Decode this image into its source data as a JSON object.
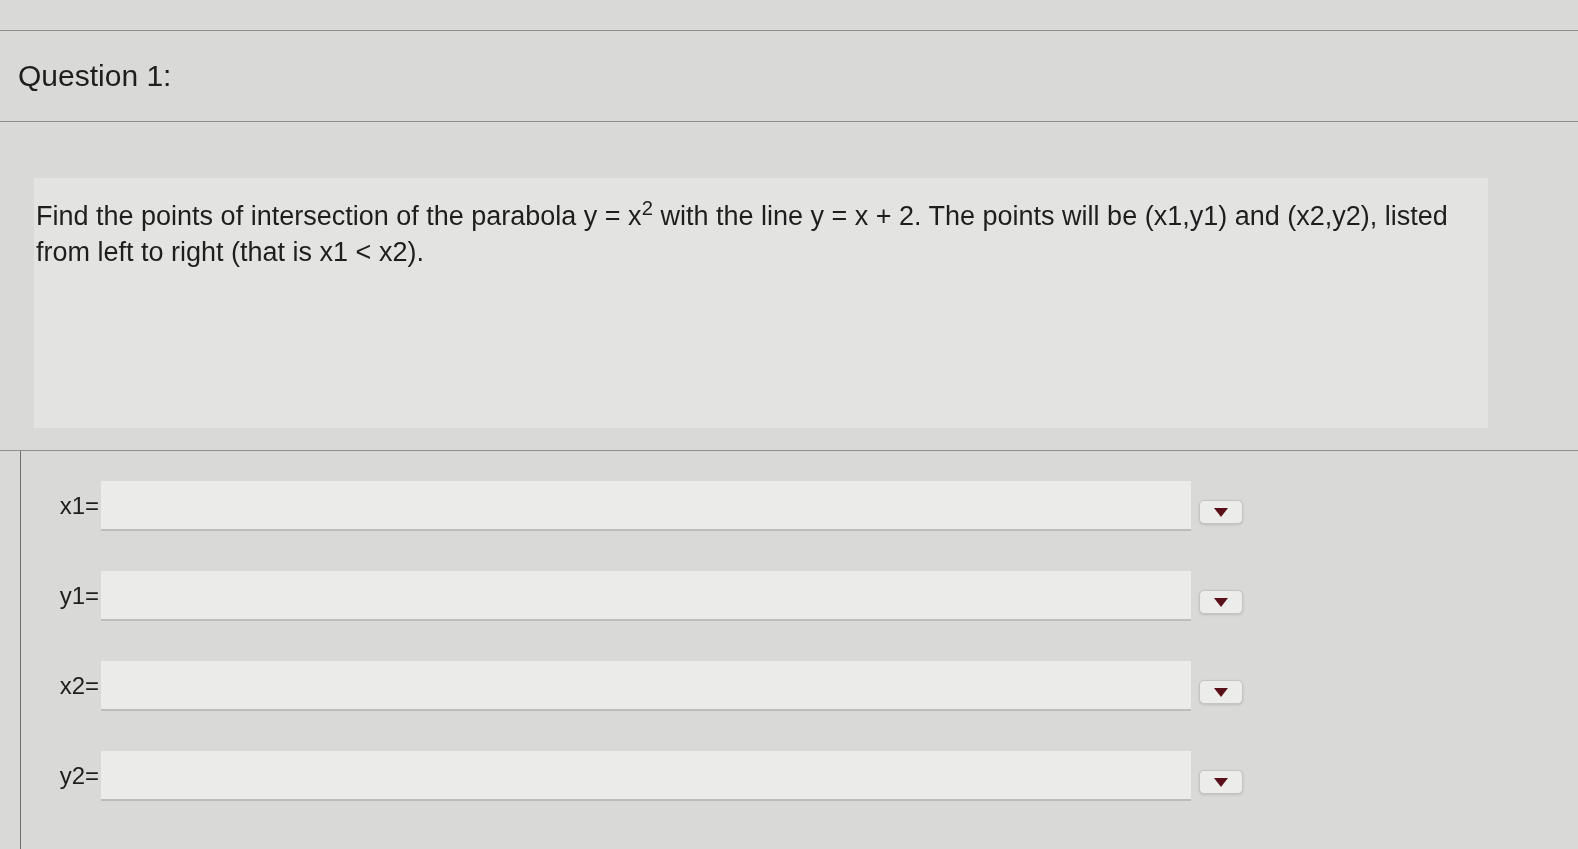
{
  "question": {
    "title": "Question 1:",
    "prompt": "Find the points of intersection of the parabola y = x$^{2}$ with the line y = x + 2. The points will be (x1,y1) and (x2,y2), listed from left to right (that is x1 < x2)."
  },
  "answers": [
    {
      "label": "x1="
    },
    {
      "label": "y1="
    },
    {
      "label": "x2="
    },
    {
      "label": "y2="
    }
  ]
}
